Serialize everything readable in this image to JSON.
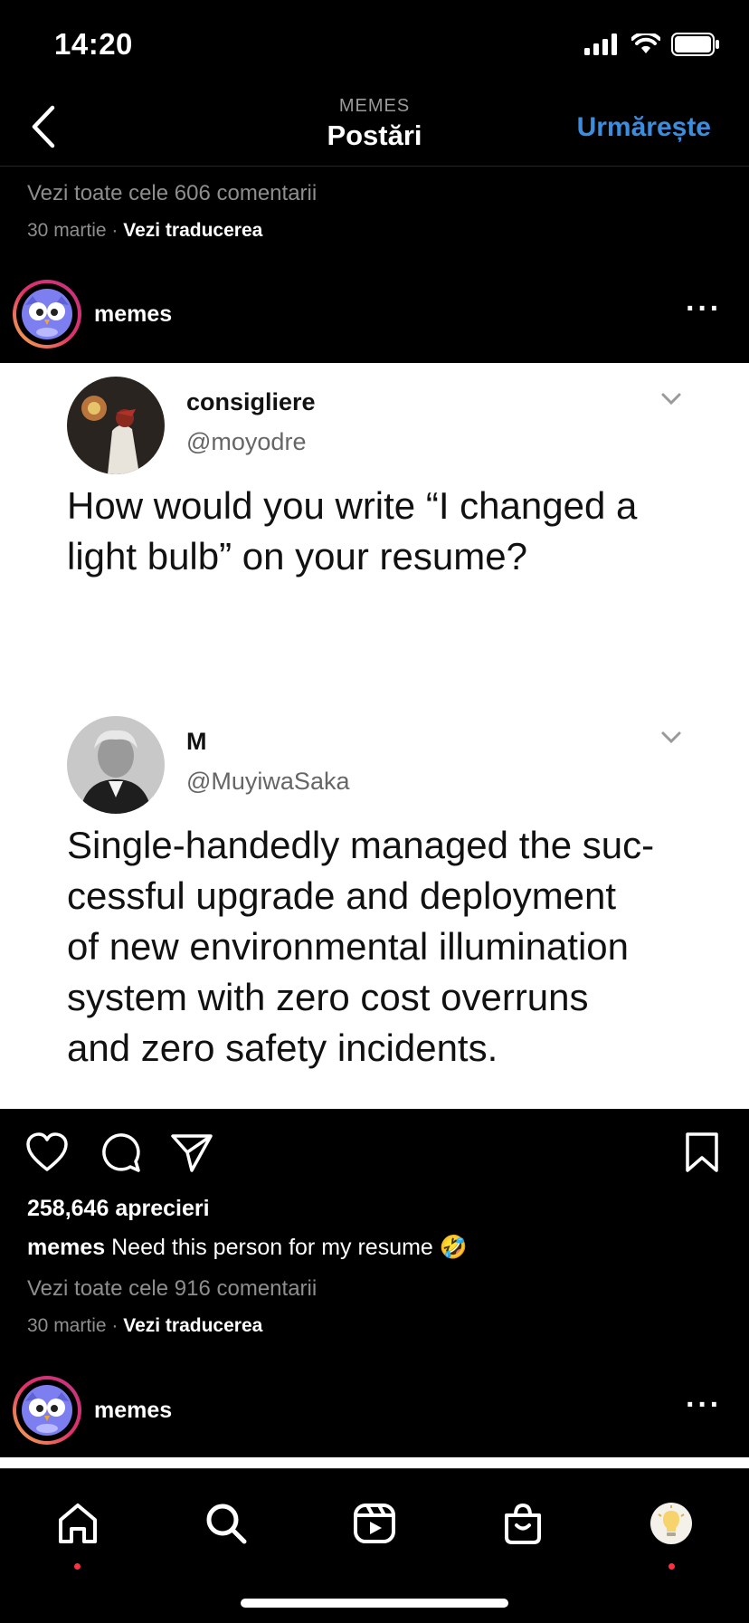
{
  "status_bar": {
    "time": "14:20"
  },
  "nav": {
    "subtitle": "MEMES",
    "title": "Postări",
    "follow_label": "Urmărește"
  },
  "previous_post": {
    "comments_link": "Vezi toate cele 606 comentarii",
    "date": "30 martie",
    "translate_label": "Vezi traducerea"
  },
  "post": {
    "username": "memes",
    "tweets": [
      {
        "name": "consigliere",
        "handle": "@moyodre",
        "text_lines": [
          "How would you write “I changed a",
          "light bulb” on your resume?"
        ]
      },
      {
        "name": "M",
        "handle": "@MuyiwaSaka",
        "text_lines": [
          "Single-handedly managed the suc-",
          "cessful upgrade and deployment",
          "of new environmental illumination",
          "system with zero cost overruns",
          "and zero safety incidents."
        ]
      }
    ],
    "likes": "258,646 aprecieri",
    "caption_user": "memes",
    "caption_text": "Need this person for my resume 🤣",
    "comments_link": "Vezi toate cele 916 comentarii",
    "date": "30 martie",
    "translate_label": "Vezi traducerea"
  },
  "next_post": {
    "username": "memes"
  },
  "tabbar": {
    "items": [
      {
        "name": "home",
        "icon": "home-icon",
        "active": true
      },
      {
        "name": "search",
        "icon": "search-icon"
      },
      {
        "name": "reels",
        "icon": "reels-icon"
      },
      {
        "name": "shop",
        "icon": "shop-icon"
      },
      {
        "name": "profile",
        "icon": "profile-avatar"
      }
    ]
  },
  "colors": {
    "accent": "#3c8dde",
    "background": "#000000",
    "notification": "#ff3040"
  }
}
